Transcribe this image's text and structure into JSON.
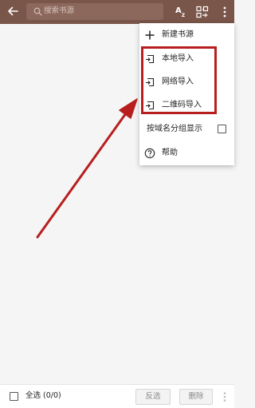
{
  "toolbar": {
    "search_placeholder": "搜索书源",
    "sort_label": "A",
    "sort_sub": "Z"
  },
  "menu": {
    "items": [
      {
        "label": "新建书源",
        "icon": "plus-icon"
      },
      {
        "label": "本地导入",
        "icon": "import-icon"
      },
      {
        "label": "网络导入",
        "icon": "import-icon"
      },
      {
        "label": "二维码导入",
        "icon": "import-icon"
      },
      {
        "label": "按域名分组显示",
        "icon": "checkbox",
        "checked": false
      },
      {
        "label": "帮助",
        "icon": "help-icon"
      }
    ]
  },
  "bottombar": {
    "select_all_label": "全选 (0/0)",
    "invert_label": "反选",
    "delete_label": "删除"
  },
  "colors": {
    "toolbar": "#7a5549",
    "annotation": "#b81e1e"
  }
}
